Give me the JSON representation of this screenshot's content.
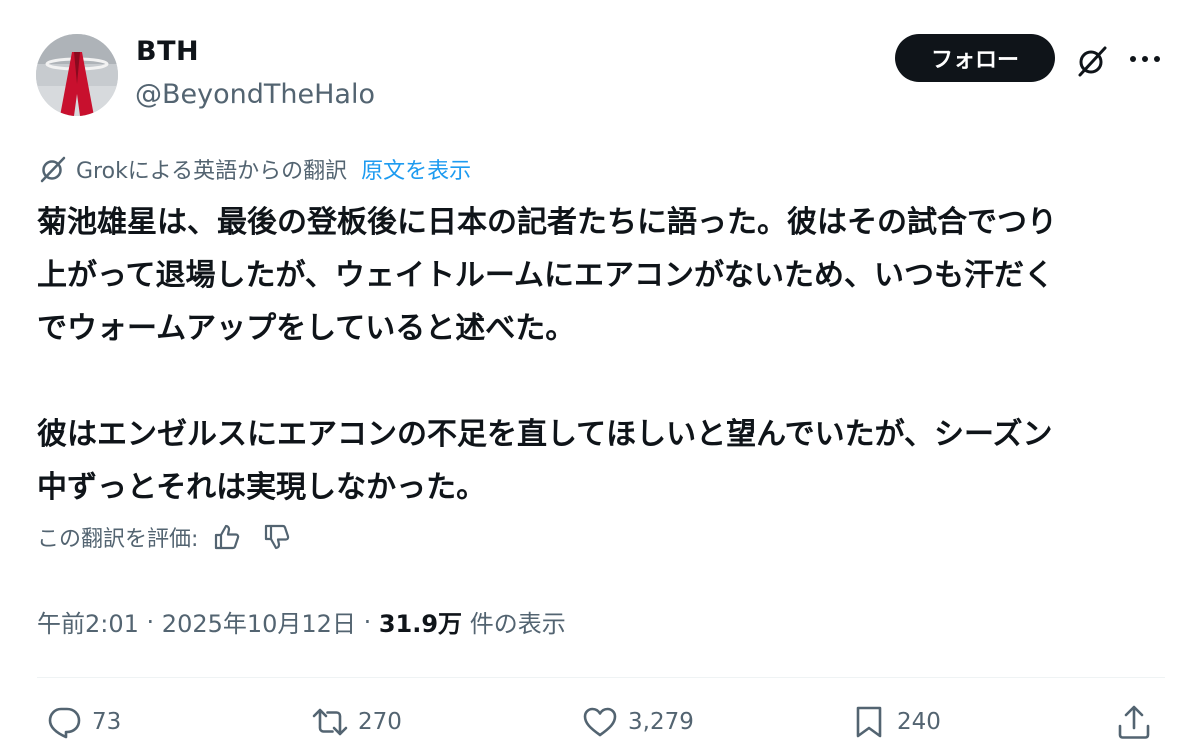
{
  "author": {
    "name": "BTH",
    "handle": "@BeyondTheHalo",
    "avatar_icon": "halo-logo-avatar"
  },
  "header": {
    "follow_label": "フォロー",
    "grok_icon": "grok-icon",
    "more_icon": "more-options-icon"
  },
  "translation": {
    "notice": "Grokによる英語からの翻訳",
    "show_original": "原文を表示",
    "rate_label": "この翻訳を評価:"
  },
  "tweet": {
    "text": "菊池雄星は、最後の登板後に日本の記者たちに語った。彼はその試合でつり\n上がって退場したが、ウェイトルームにエアコンがないため、いつも汗だく\nでウォームアップをしていると述べた。\n\n彼はエンゼルスにエアコンの不足を直してほしいと望んでいたが、シーズン\n中ずっとそれは実現しなかった。",
    "time": "午前2:01",
    "date": "2025年10月12日",
    "separator": " · ",
    "views": "31.9万",
    "views_suffix": "件の表示"
  },
  "actions": {
    "replies": "73",
    "reposts": "270",
    "likes": "3,279",
    "bookmarks": "240"
  },
  "colors": {
    "text": "#0f1419",
    "secondary": "#536471",
    "link": "#1d9bf0",
    "divider": "#eff3f4"
  }
}
